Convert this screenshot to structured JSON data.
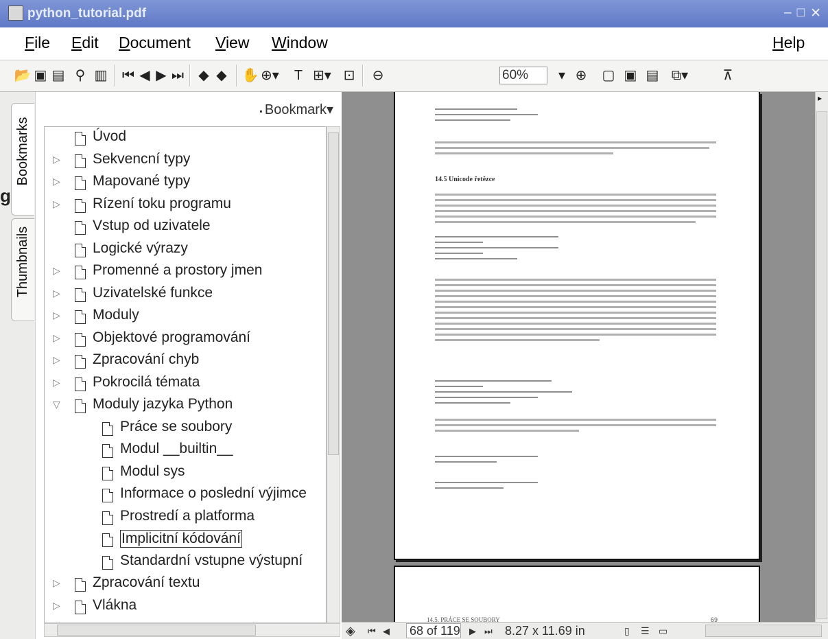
{
  "window": {
    "title": "python_tutorial.pdf",
    "controls": [
      "–",
      "□",
      "✕"
    ]
  },
  "menu": {
    "items": [
      "File",
      "Edit",
      "Document",
      "View",
      "Window"
    ],
    "help": "Help"
  },
  "toolbar": {
    "zoom_value": "60%",
    "icons": [
      "open-icon",
      "save-icon",
      "print-icon",
      "find-icon",
      "show-hide-navigation-icon",
      "first-page-icon",
      "previous-page-icon",
      "next-page-icon",
      "last-page-icon",
      "go-back-icon",
      "go-forward-icon",
      "hand-tool-icon",
      "zoom-tool-icon",
      "text-select-tool-icon",
      "column-select-tool-icon",
      "crop-tool-icon",
      "zoom-out-icon",
      "zoom-in-icon",
      "actual-size-icon",
      "fit-page-icon",
      "fit-width-icon",
      "rotate-icon",
      "reflow-icon"
    ]
  },
  "side_tabs": {
    "bookmarks": "Bookmarks",
    "thumbnails": "Thumbnails"
  },
  "bookmarks": {
    "menu_label": "Bookmark▾",
    "items": [
      {
        "label": "Úvod",
        "level": 1,
        "expander": ""
      },
      {
        "label": "Sekvencní typy",
        "level": 1,
        "expander": "▷"
      },
      {
        "label": "Mapované typy",
        "level": 1,
        "expander": "▷"
      },
      {
        "label": "Rízení toku programu",
        "level": 1,
        "expander": "▷"
      },
      {
        "label": "Vstup od uzivatele",
        "level": 1,
        "expander": ""
      },
      {
        "label": "Logické výrazy",
        "level": 1,
        "expander": ""
      },
      {
        "label": "Promenné a prostory jmen",
        "level": 1,
        "expander": "▷"
      },
      {
        "label": "Uzivatelské funkce",
        "level": 1,
        "expander": "▷"
      },
      {
        "label": "Moduly",
        "level": 1,
        "expander": "▷"
      },
      {
        "label": "Objektové programování",
        "level": 1,
        "expander": "▷"
      },
      {
        "label": "Zpracování chyb",
        "level": 1,
        "expander": "▷"
      },
      {
        "label": "Pokrocilá témata",
        "level": 1,
        "expander": "▷"
      },
      {
        "label": "Moduly jazyka Python",
        "level": 1,
        "expander": "▽"
      },
      {
        "label": "Práce se soubory",
        "level": 2,
        "expander": ""
      },
      {
        "label": "Modul __builtin__",
        "level": 2,
        "expander": ""
      },
      {
        "label": "Modul sys",
        "level": 2,
        "expander": ""
      },
      {
        "label": "Informace o poslední výjimce",
        "level": 2,
        "expander": ""
      },
      {
        "label": "Prostredí a platforma",
        "level": 2,
        "expander": ""
      },
      {
        "label": "Implicitní kódování",
        "level": 2,
        "expander": "",
        "selected": true
      },
      {
        "label": "Standardní vstupne výstupní",
        "level": 2,
        "expander": ""
      },
      {
        "label": "Zpracování textu",
        "level": 1,
        "expander": "▷"
      },
      {
        "label": "Vlákna",
        "level": 1,
        "expander": "▷"
      }
    ]
  },
  "document": {
    "section_heading": "14.5   Unicode řetězce",
    "page2_footer": "14.5. PRÁCE SE SOUBORY",
    "page2_number": "69"
  },
  "status": {
    "page_display": "68 of 119",
    "page_size": "8.27 x 11.69 in"
  },
  "edge_glyph": "g"
}
